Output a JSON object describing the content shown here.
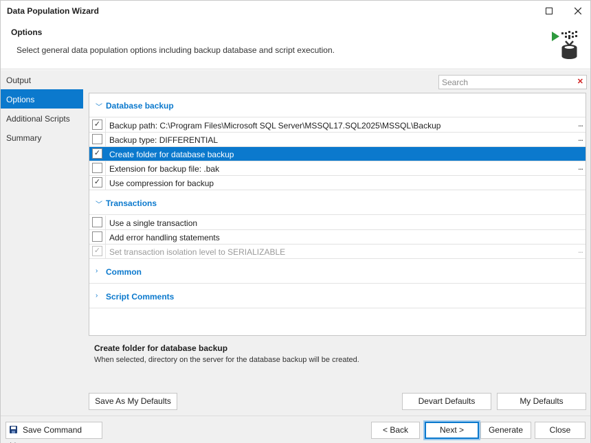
{
  "window": {
    "title": "Data Population Wizard"
  },
  "header": {
    "title": "Options",
    "description": "Select general data population options including backup database and script execution."
  },
  "nav": {
    "items": [
      {
        "label": "Output",
        "selected": false
      },
      {
        "label": "Options",
        "selected": true
      },
      {
        "label": "Additional Scripts",
        "selected": false
      },
      {
        "label": "Summary",
        "selected": false
      }
    ]
  },
  "search": {
    "placeholder": "Search"
  },
  "grid": {
    "categories": [
      {
        "label": "Database backup",
        "expanded": true,
        "rows": [
          {
            "label": "Backup path: C:\\Program Files\\Microsoft SQL Server\\MSSQL17.SQL2025\\MSSQL\\Backup",
            "checked": true,
            "ellipsis": "..."
          },
          {
            "label": "Backup type: DIFFERENTIAL",
            "checked": false,
            "ellipsis": "..."
          },
          {
            "label": "Create folder for database backup",
            "checked": true,
            "selected": true
          },
          {
            "label": "Extension for backup file: .bak",
            "checked": false,
            "ellipsis": "..."
          },
          {
            "label": "Use compression for backup",
            "checked": true
          }
        ]
      },
      {
        "label": "Transactions",
        "expanded": true,
        "rows": [
          {
            "label": "Use a single transaction",
            "checked": false
          },
          {
            "label": "Add error handling statements",
            "checked": false
          },
          {
            "label": "Set transaction isolation level to SERIALIZABLE",
            "checked": true,
            "disabled": true,
            "ellipsis": "..."
          }
        ]
      },
      {
        "label": "Common",
        "expanded": false
      },
      {
        "label": "Script Comments",
        "expanded": false
      }
    ]
  },
  "description": {
    "title": "Create folder for database backup",
    "text": "When selected, directory on the server for the database backup will be created."
  },
  "buttons": {
    "save_as_defaults": "Save As My Defaults",
    "devart_defaults": "Devart Defaults",
    "my_defaults": "My Defaults",
    "save_command_line": "Save Command Line...",
    "back": "< Back",
    "next": "Next >",
    "generate": "Generate",
    "close": "Close"
  },
  "icons": {
    "maximize": "maximize-icon",
    "close": "close-icon",
    "logo": "data-populate-icon",
    "save": "floppy-disk-icon"
  },
  "colors": {
    "accent": "#0b79cd",
    "logo_arrow": "#2e9a3e"
  }
}
